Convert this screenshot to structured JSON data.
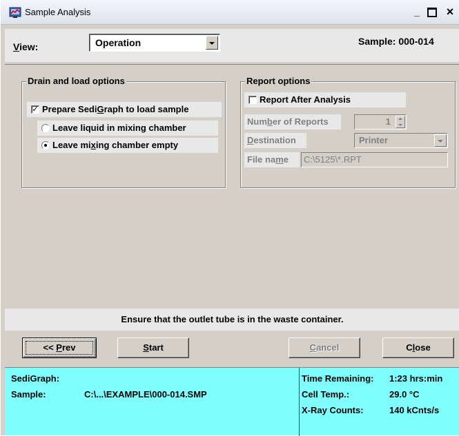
{
  "window": {
    "title": "Sample Analysis",
    "minimize_glyph": "_",
    "close_glyph": "×"
  },
  "toolbar": {
    "view_label": "View:",
    "view_accelerator": "V",
    "view_rest": "iew:",
    "view_value": "Operation",
    "sample_label": "Sample: 000-014"
  },
  "drain": {
    "title": "Drain and load options",
    "prepare": {
      "label": "Prepare SediGraph to load sample",
      "pre": "Prepare Sedi",
      "acc": "G",
      "post": "raph to load sample",
      "checked": true
    },
    "leave_liquid": {
      "label": "Leave liquid in mixing chamber",
      "selected": false
    },
    "leave_empty": {
      "label": "Leave mixing chamber empty",
      "pre": "Leave mi",
      "acc": "x",
      "post": "ing chamber empty",
      "selected": true
    }
  },
  "report": {
    "title": "Report options",
    "after_analysis": {
      "label": "Report After Analysis",
      "checked": false
    },
    "num_reports": {
      "label": "Number of Reports",
      "pre": "Num",
      "acc": "b",
      "post": "er of Reports",
      "value": "1"
    },
    "destination": {
      "label": "Destination",
      "acc": "D",
      "post": "estination",
      "value": "Printer"
    },
    "file_name": {
      "label": "File name",
      "pre": "File na",
      "acc": "m",
      "post": "e",
      "value": "C:\\5125\\*.RPT"
    }
  },
  "message": "Ensure that the outlet tube is in the waste container.",
  "buttons": {
    "prev": {
      "pre": "<< ",
      "acc": "P",
      "post": "rev",
      "label": "<< Prev"
    },
    "start": {
      "acc": "S",
      "post": "tart",
      "label": "Start"
    },
    "cancel": {
      "acc": "C",
      "post": "ancel",
      "label": "Cancel",
      "enabled": false
    },
    "close": {
      "pre": "C",
      "acc": "l",
      "post": "ose",
      "label": "Close"
    }
  },
  "status": {
    "instrument": "SediGraph:",
    "sample_label": "Sample:",
    "sample_path": "C:\\...\\EXAMPLE\\000-014.SMP",
    "time_label": "Time Remaining:",
    "time_value": "1:23 hrs:min",
    "temp_label": "Cell Temp.:",
    "temp_value": "29.0 °C",
    "xray_label": "X-Ray Counts:",
    "xray_value": "140 kCnts/s",
    "background_color": "#80ffff"
  }
}
